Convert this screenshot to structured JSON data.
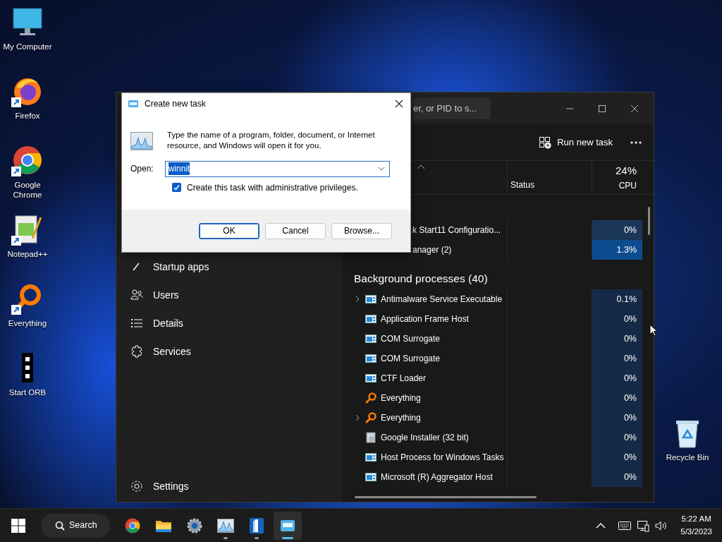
{
  "desktop_icons": [
    {
      "kind": "computer",
      "label": "My Computer",
      "shortcut": false
    },
    {
      "kind": "firefox",
      "label": "Firefox",
      "shortcut": true
    },
    {
      "kind": "chrome",
      "label": "Google Chrome",
      "shortcut": true
    },
    {
      "kind": "notepad",
      "label": "Notepad++",
      "shortcut": true
    },
    {
      "kind": "everything",
      "label": "Everything",
      "shortcut": true
    },
    {
      "kind": "orb",
      "label": "Start ORB",
      "shortcut": false
    }
  ],
  "recycle_bin": {
    "label": "Recycle Bin"
  },
  "task_manager": {
    "search": {
      "placeholder": "er, or PID to s..."
    },
    "nav_items": [
      {
        "kind": "startup",
        "label": "Startup apps"
      },
      {
        "kind": "users",
        "label": "Users"
      },
      {
        "kind": "details",
        "label": "Details"
      },
      {
        "kind": "services",
        "label": "Services"
      }
    ],
    "settings": {
      "label": "Settings"
    },
    "run_new_task": "Run new task",
    "columns": {
      "status": "Status",
      "cpu_total": "24%",
      "cpu": "CPU"
    },
    "apps_rows": [
      {
        "kind": "covered",
        "name": "k Start11 Configuratio...",
        "cpu": "0%",
        "color": "#1a3658"
      },
      {
        "kind": "covered",
        "name": "anager (2)",
        "cpu": "1.3%",
        "color": "#0e4c90"
      }
    ],
    "group": "Background processes (40)",
    "background_rows": [
      {
        "kind": "service",
        "name": "Antimalware Service Executable",
        "cpu": "0.1%",
        "expandable": true,
        "color": "#152a46"
      },
      {
        "kind": "service",
        "name": "Application Frame Host",
        "cpu": "0%",
        "expandable": false,
        "color": "#152a46"
      },
      {
        "kind": "service",
        "name": "COM Surrogate",
        "cpu": "0%",
        "expandable": false,
        "color": "#152a46"
      },
      {
        "kind": "service",
        "name": "COM Surrogate",
        "cpu": "0%",
        "expandable": false,
        "color": "#152a46"
      },
      {
        "kind": "service",
        "name": "CTF Loader",
        "cpu": "0%",
        "expandable": false,
        "color": "#152a46"
      },
      {
        "kind": "everything",
        "name": "Everything",
        "cpu": "0%",
        "expandable": false,
        "color": "#152a46"
      },
      {
        "kind": "everything",
        "name": "Everything",
        "cpu": "0%",
        "expandable": true,
        "color": "#152a46"
      },
      {
        "kind": "installer",
        "name": "Google Installer (32 bit)",
        "cpu": "0%",
        "expandable": false,
        "color": "#152a46"
      },
      {
        "kind": "service",
        "name": "Host Process for Windows Tasks",
        "cpu": "0%",
        "expandable": false,
        "color": "#152a46"
      },
      {
        "kind": "service",
        "name": "Microsoft (R) Aggregator Host",
        "cpu": "0%",
        "expandable": false,
        "color": "#152a46"
      }
    ]
  },
  "dialog": {
    "title": "Create new task",
    "message": "Type the name of a program, folder, document, or Internet resource, and Windows will open it for you.",
    "open_label": "Open:",
    "value": "winnit",
    "value_selected": true,
    "admin": {
      "label": "Create this task with administrative privileges.",
      "checked": true
    },
    "buttons": [
      {
        "label": "OK",
        "default": true
      },
      {
        "label": "Cancel",
        "default": false
      },
      {
        "label": "Browse...",
        "default": false
      }
    ]
  },
  "taskbar": {
    "search": "Search",
    "apps": [
      {
        "kind": "chrome",
        "running": false,
        "active": false
      },
      {
        "kind": "folder",
        "running": false,
        "active": false
      },
      {
        "kind": "settings",
        "running": false,
        "active": false
      },
      {
        "kind": "taskmgr",
        "running": true,
        "active": false
      },
      {
        "kind": "pillar",
        "running": true,
        "active": false
      },
      {
        "kind": "run",
        "running": true,
        "active": true
      }
    ],
    "clock": {
      "time": "5:22 AM",
      "date": "5/3/2023"
    }
  }
}
